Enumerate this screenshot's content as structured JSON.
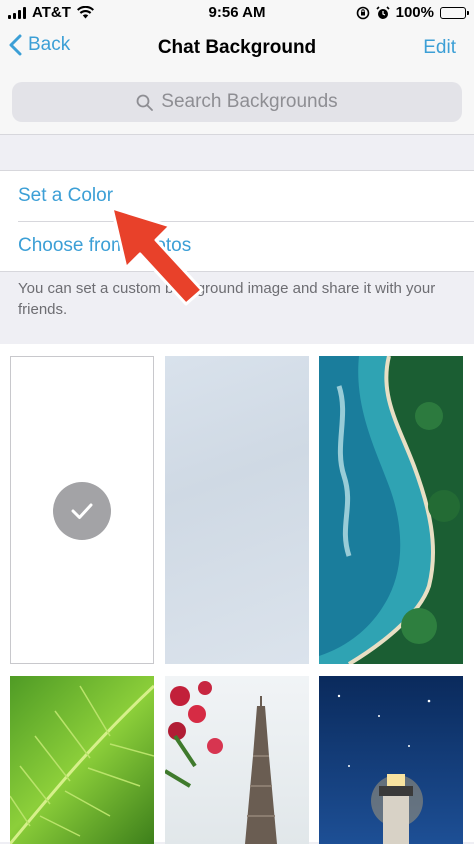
{
  "status": {
    "carrier": "AT&T",
    "time": "9:56 AM",
    "battery": "100%"
  },
  "nav": {
    "back_label": "Back",
    "title": "Chat Background",
    "edit_label": "Edit"
  },
  "search": {
    "placeholder": "Search Backgrounds"
  },
  "options": [
    {
      "label": "Set a Color"
    },
    {
      "label": "Choose from Photos"
    }
  ],
  "hint": "You can set a custom background image and share it with your friends.",
  "wallpapers": [
    {
      "name": "plain-white",
      "selected": true
    },
    {
      "name": "light-blue-texture",
      "selected": false
    },
    {
      "name": "aerial-beach",
      "selected": false
    },
    {
      "name": "green-leaf",
      "selected": false
    },
    {
      "name": "eiffel-tower",
      "selected": false
    },
    {
      "name": "lighthouse-night",
      "selected": false
    }
  ],
  "colors": {
    "accent": "#3c9fd6",
    "annotation_arrow": "#e8412a"
  }
}
